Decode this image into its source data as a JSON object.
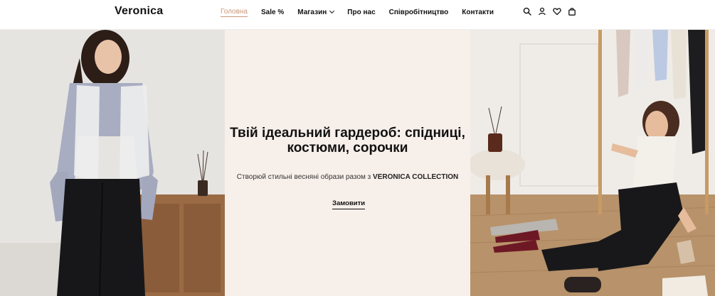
{
  "brand": {
    "logo": "Veronica"
  },
  "nav": {
    "items": [
      {
        "label": "Головна",
        "active": true
      },
      {
        "label": "Sale %"
      },
      {
        "label": "Магазин",
        "has_dropdown": true
      },
      {
        "label": "Про нас"
      },
      {
        "label": "Співробітництво"
      },
      {
        "label": "Контакти"
      }
    ]
  },
  "header_icons": [
    "search-icon",
    "user-icon",
    "heart-icon",
    "bag-icon"
  ],
  "hero": {
    "title_line1": "Твій ідеальний гардероб: спідниці,",
    "title_line2": "костюми, сорочки",
    "subtitle_prefix": "Створюй стильні весняні образи разом з ",
    "subtitle_brand": "VERONICA COLLECTION",
    "cta": "Замовити"
  },
  "colors": {
    "accent": "#c9977a",
    "center_panel_bg": "#f7efea",
    "text": "#111111"
  }
}
